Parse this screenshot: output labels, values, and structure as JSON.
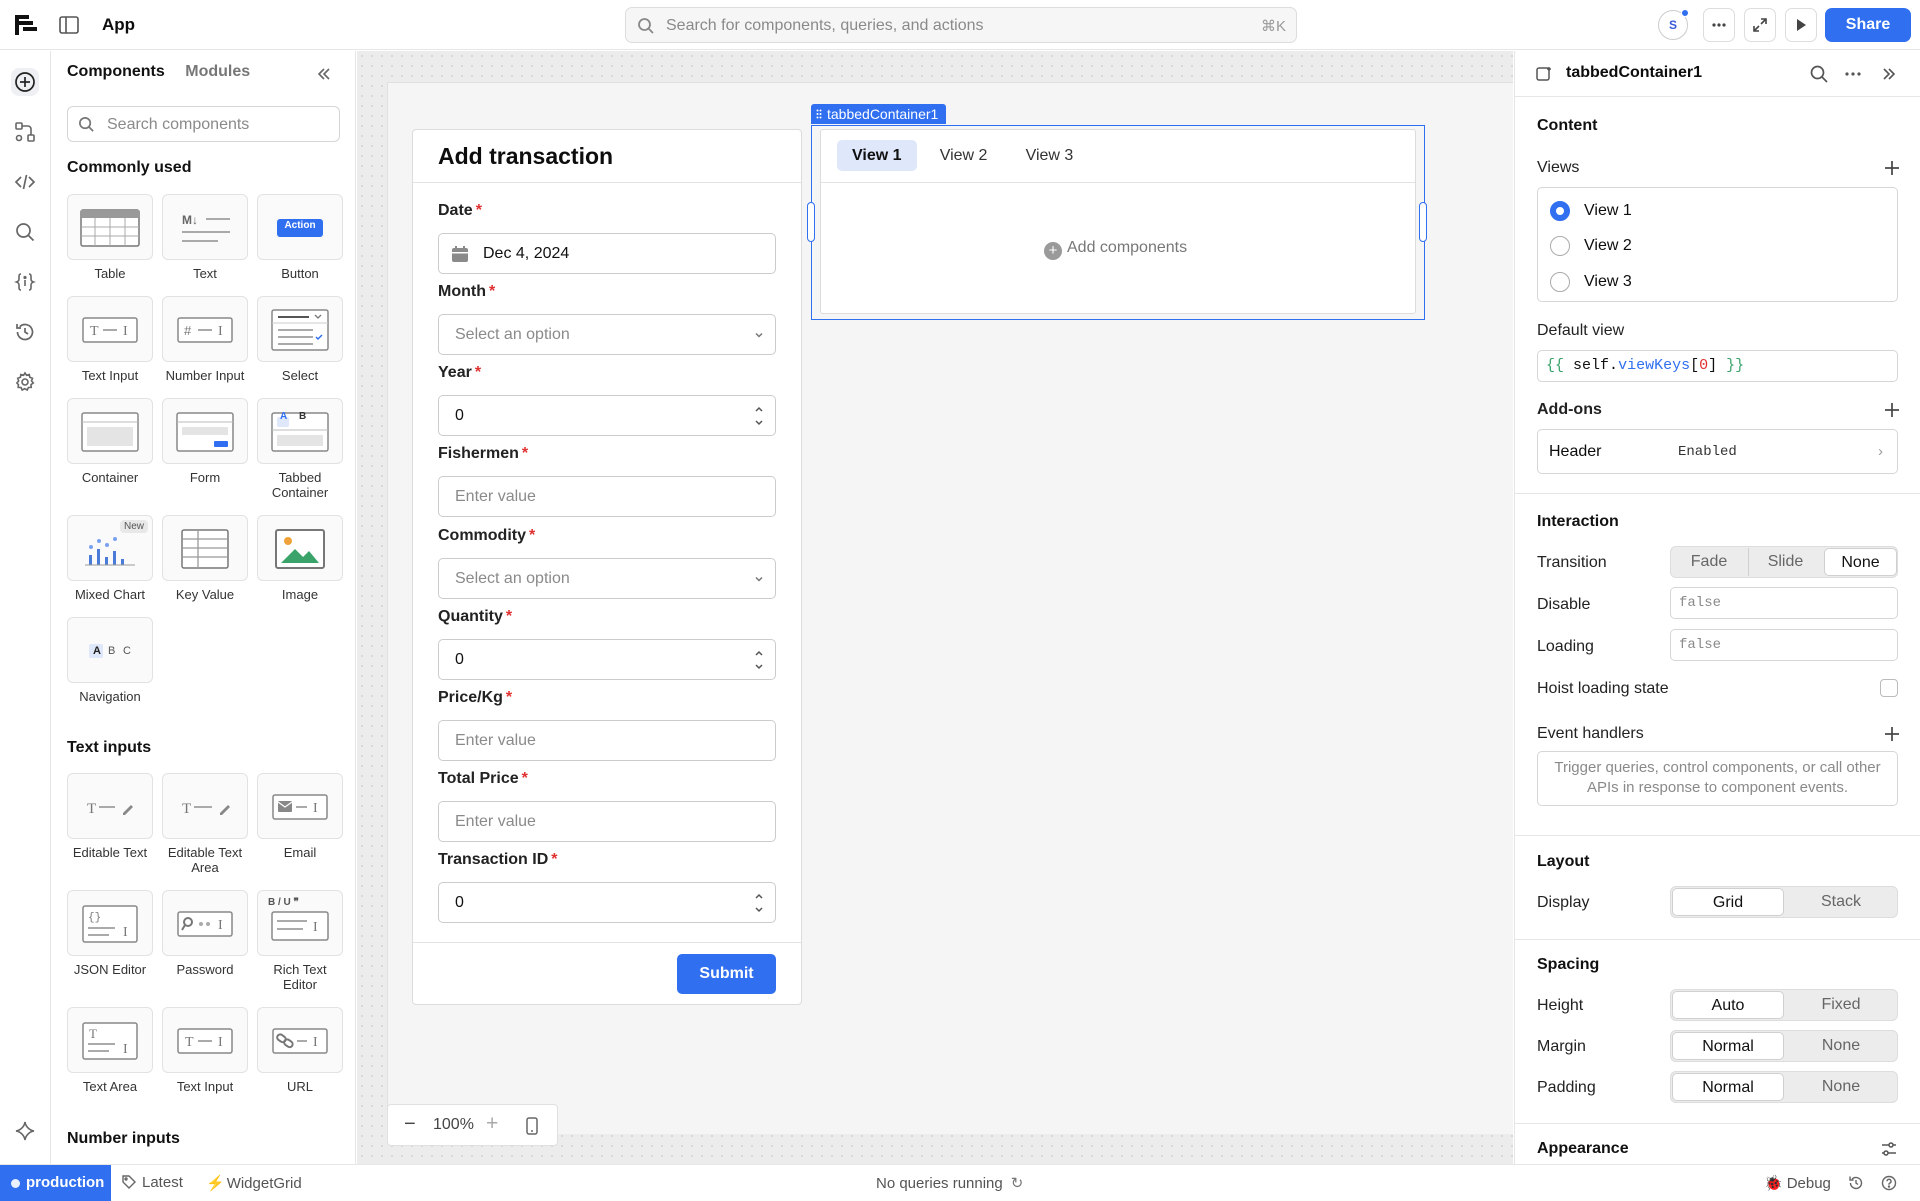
{
  "topbar": {
    "app_title": "App",
    "search_placeholder": "Search for components, queries, and actions",
    "search_shortcut": "⌘K",
    "avatar_initial": "S",
    "share_label": "Share"
  },
  "components_panel": {
    "tabs": [
      "Components",
      "Modules"
    ],
    "search_placeholder": "Search components",
    "sections": {
      "commonly_used": "Commonly used",
      "text_inputs": "Text inputs",
      "number_inputs": "Number inputs"
    },
    "commonly_used": [
      {
        "label": "Table",
        "icon": "table-icon"
      },
      {
        "label": "Text",
        "icon": "markdown-text-icon"
      },
      {
        "label": "Button",
        "icon": "button-icon",
        "badge": "Action"
      },
      {
        "label": "Text Input",
        "icon": "text-input-icon"
      },
      {
        "label": "Number Input",
        "icon": "number-input-icon"
      },
      {
        "label": "Select",
        "icon": "select-icon"
      },
      {
        "label": "Container",
        "icon": "container-icon"
      },
      {
        "label": "Form",
        "icon": "form-icon"
      },
      {
        "label": "Tabbed Container",
        "icon": "tabbed-container-icon",
        "letters": [
          "A",
          "B"
        ]
      },
      {
        "label": "Mixed Chart",
        "icon": "mixed-chart-icon",
        "badge": "New"
      },
      {
        "label": "Key Value",
        "icon": "key-value-icon"
      },
      {
        "label": "Image",
        "icon": "image-icon"
      },
      {
        "label": "Navigation",
        "icon": "navigation-icon",
        "letters": [
          "A",
          "B",
          "C"
        ]
      }
    ],
    "text_inputs": [
      {
        "label": "Editable Text",
        "icon": "editable-text-icon"
      },
      {
        "label": "Editable Text Area",
        "icon": "editable-text-area-icon"
      },
      {
        "label": "Email",
        "icon": "email-icon"
      },
      {
        "label": "JSON Editor",
        "icon": "json-editor-icon"
      },
      {
        "label": "Password",
        "icon": "password-icon"
      },
      {
        "label": "Rich Text Editor",
        "icon": "rich-text-editor-icon",
        "letters": "B / U ❞"
      },
      {
        "label": "Text Area",
        "icon": "text-area-icon"
      },
      {
        "label": "Text Input",
        "icon": "text-input-icon"
      },
      {
        "label": "URL",
        "icon": "url-icon"
      }
    ]
  },
  "form": {
    "title": "Add transaction",
    "required_marker": "*",
    "fields": [
      {
        "label": "Date",
        "kind": "date",
        "value": "Dec 4, 2024"
      },
      {
        "label": "Month",
        "kind": "select",
        "placeholder": "Select an option"
      },
      {
        "label": "Year",
        "kind": "number",
        "value": "0"
      },
      {
        "label": "Fishermen",
        "kind": "text",
        "placeholder": "Enter value"
      },
      {
        "label": "Commodity",
        "kind": "select",
        "placeholder": "Select an option"
      },
      {
        "label": "Quantity",
        "kind": "number",
        "value": "0"
      },
      {
        "label": "Price/Kg",
        "kind": "text",
        "placeholder": "Enter value"
      },
      {
        "label": "Total Price",
        "kind": "text",
        "placeholder": "Enter value"
      },
      {
        "label": "Transaction ID",
        "kind": "number",
        "value": "0"
      }
    ],
    "submit_label": "Submit"
  },
  "tabbed_container": {
    "selection_label": "tabbedContainer1",
    "tabs": [
      "View 1",
      "View 2",
      "View 3"
    ],
    "active_tab": "View 1",
    "empty_text": "Add components"
  },
  "zoom": {
    "level": "100%"
  },
  "inspector": {
    "component_name": "tabbedContainer1",
    "content": {
      "title": "Content",
      "views_label": "Views",
      "views": [
        "View 1",
        "View 2",
        "View 3"
      ],
      "selected_view": "View 1",
      "default_view_label": "Default view",
      "default_view_parts": [
        "{{",
        " ",
        "self",
        ".",
        "viewKeys",
        "[",
        "0",
        "]",
        " ",
        "}}"
      ],
      "addons_label": "Add-ons",
      "addon_name": "Header",
      "addon_status": "Enabled"
    },
    "interaction": {
      "title": "Interaction",
      "transition_label": "Transition",
      "transition_options": [
        "Fade",
        "Slide",
        "None"
      ],
      "transition_selected": "None",
      "disable_label": "Disable",
      "disable_value": "false",
      "loading_label": "Loading",
      "loading_value": "false",
      "hoist_label": "Hoist loading state",
      "hoist_checked": false,
      "event_handlers_label": "Event handlers",
      "event_handlers_hint": "Trigger queries, control components, or call other APIs in response to component events."
    },
    "layout": {
      "title": "Layout",
      "display_label": "Display",
      "display_options": [
        "Grid",
        "Stack"
      ],
      "display_selected": "Grid"
    },
    "spacing": {
      "title": "Spacing",
      "height_label": "Height",
      "height_options": [
        "Auto",
        "Fixed"
      ],
      "height_selected": "Auto",
      "margin_label": "Margin",
      "margin_options": [
        "Normal",
        "None"
      ],
      "margin_selected": "Normal",
      "padding_label": "Padding",
      "padding_options": [
        "Normal",
        "None"
      ],
      "padding_selected": "Normal"
    },
    "appearance": {
      "title": "Appearance"
    }
  },
  "statusbar": {
    "environment": "production",
    "version": "Latest",
    "branch": "WidgetGrid",
    "queries_status": "No queries running",
    "debug_label": "Debug"
  },
  "colors": {
    "accent": "#2f6ff0",
    "required": "#e03131",
    "active_tab_bg": "#dfe7fb",
    "canvas_bg": "#f5f5f5"
  }
}
